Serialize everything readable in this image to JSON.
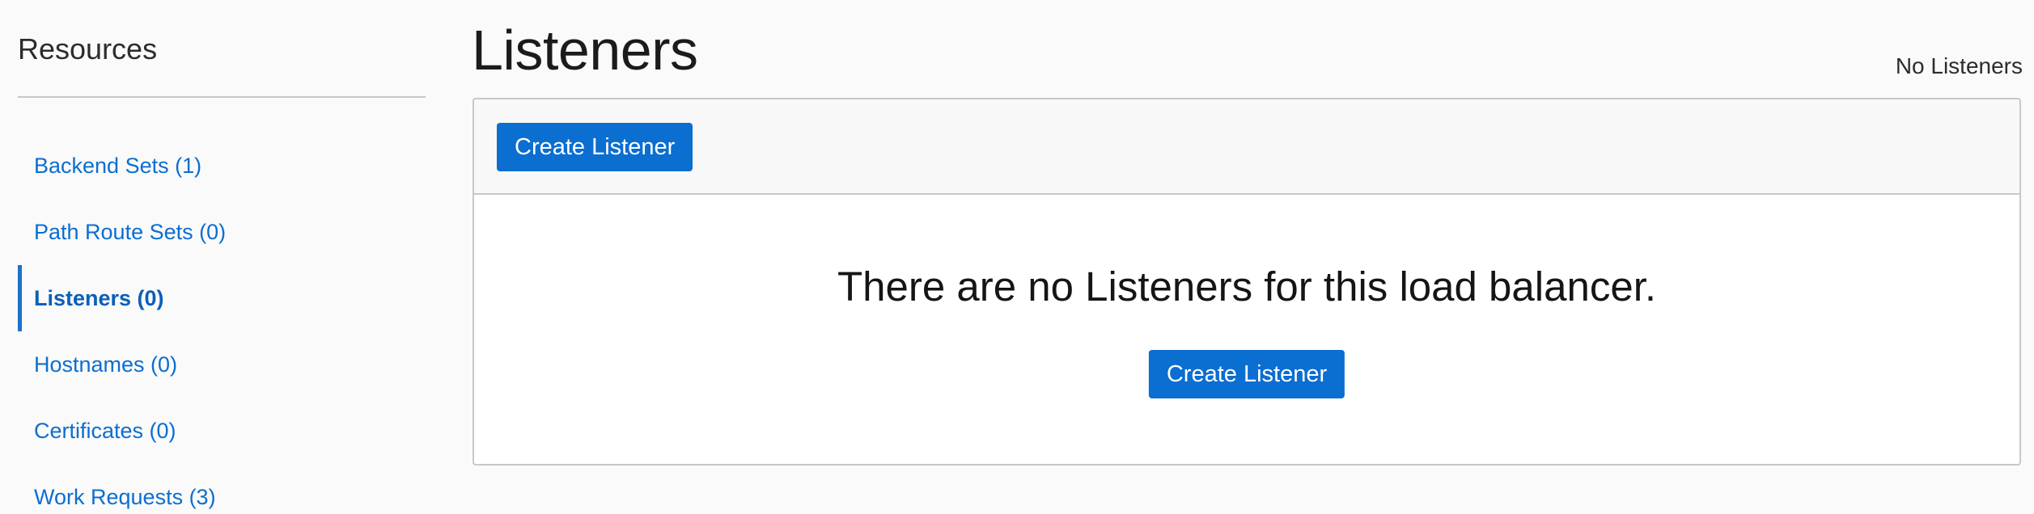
{
  "sidebar": {
    "title": "Resources",
    "items": [
      {
        "label": "Backend Sets (1)",
        "active": false
      },
      {
        "label": "Path Route Sets (0)",
        "active": false
      },
      {
        "label": "Listeners (0)",
        "active": true
      },
      {
        "label": "Hostnames (0)",
        "active": false
      },
      {
        "label": "Certificates (0)",
        "active": false
      },
      {
        "label": "Work Requests (3)",
        "active": false
      }
    ]
  },
  "main": {
    "title": "Listeners",
    "count_text": "No Listeners",
    "toolbar": {
      "create_label": "Create Listener"
    },
    "empty_state": {
      "message": "There are no Listeners for this load balancer.",
      "create_label": "Create Listener"
    }
  },
  "colors": {
    "accent": "#0b6ed1",
    "background": "#fafafa",
    "active_indicator": "#1d72c9"
  }
}
